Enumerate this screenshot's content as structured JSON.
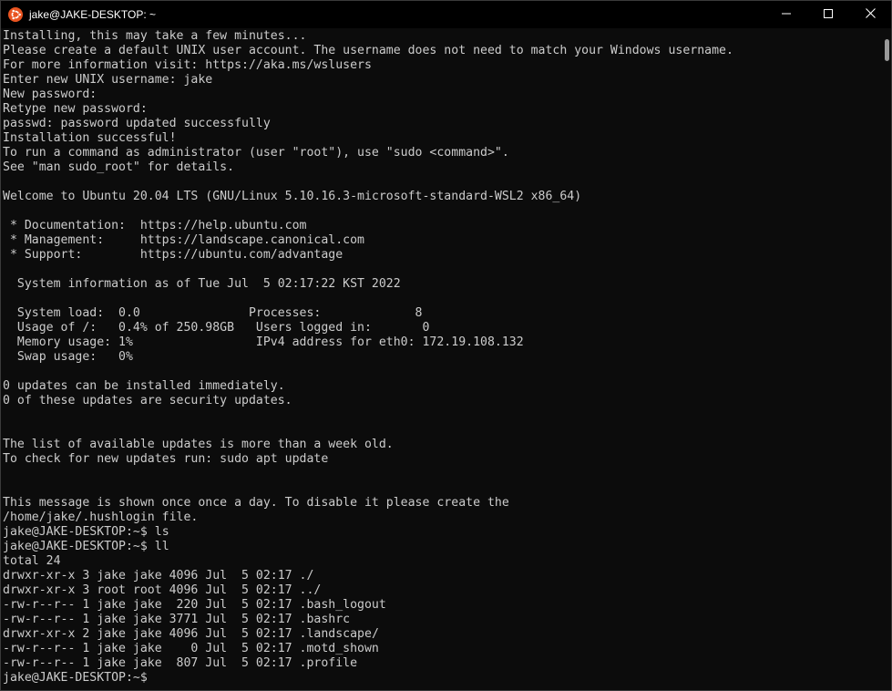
{
  "window": {
    "title": "jake@JAKE-DESKTOP: ~",
    "app_icon": "ubuntu-icon",
    "controls": [
      "minimize-icon",
      "maximize-icon",
      "close-icon"
    ]
  },
  "colors": {
    "background": "#0c0c0c",
    "text": "#cccccc",
    "prompt_green": "#13a10e",
    "directory_blue": "#3b78ff",
    "ubuntu_orange": "#e95420"
  },
  "terminal": {
    "lines": [
      [
        {
          "t": "Installing, this may take a few minutes..."
        }
      ],
      [
        {
          "t": "Please create a default UNIX user account. The username does not need to match your Windows username."
        }
      ],
      [
        {
          "t": "For more information visit: https://aka.ms/wslusers"
        }
      ],
      [
        {
          "t": "Enter new UNIX username: jake"
        }
      ],
      [
        {
          "t": "New password:"
        }
      ],
      [
        {
          "t": "Retype new password:"
        }
      ],
      [
        {
          "t": "passwd: password updated successfully"
        }
      ],
      [
        {
          "t": "Installation successful!"
        }
      ],
      [
        {
          "t": "To run a command as administrator (user \"root\"), use \"sudo <command>\"."
        }
      ],
      [
        {
          "t": "See \"man sudo_root\" for details."
        }
      ],
      [
        {
          "t": ""
        }
      ],
      [
        {
          "t": "Welcome to Ubuntu 20.04 LTS (GNU/Linux 5.10.16.3-microsoft-standard-WSL2 x86_64)"
        }
      ],
      [
        {
          "t": ""
        }
      ],
      [
        {
          "t": " * Documentation:  https://help.ubuntu.com"
        }
      ],
      [
        {
          "t": " * Management:     https://landscape.canonical.com"
        }
      ],
      [
        {
          "t": " * Support:        https://ubuntu.com/advantage"
        }
      ],
      [
        {
          "t": ""
        }
      ],
      [
        {
          "t": "  System information as of Tue Jul  5 02:17:22 KST 2022"
        }
      ],
      [
        {
          "t": ""
        }
      ],
      [
        {
          "t": "  System load:  0.0               Processes:             8"
        }
      ],
      [
        {
          "t": "  Usage of /:   0.4% of 250.98GB   Users logged in:       0"
        }
      ],
      [
        {
          "t": "  Memory usage: 1%                 IPv4 address for eth0: 172.19.108.132"
        }
      ],
      [
        {
          "t": "  Swap usage:   0%"
        }
      ],
      [
        {
          "t": ""
        }
      ],
      [
        {
          "t": "0 updates can be installed immediately."
        }
      ],
      [
        {
          "t": "0 of these updates are security updates."
        }
      ],
      [
        {
          "t": ""
        }
      ],
      [
        {
          "t": ""
        }
      ],
      [
        {
          "t": "The list of available updates is more than a week old."
        }
      ],
      [
        {
          "t": "To check for new updates run: sudo apt update"
        }
      ],
      [
        {
          "t": ""
        }
      ],
      [
        {
          "t": ""
        }
      ],
      [
        {
          "t": "This message is shown once once a day. To disable it please create the"
        }
      ],
      [
        {
          "t": "/home/jake/.hushlogin file."
        }
      ],
      [
        {
          "t": "jake@JAKE-DESKTOP:",
          "c": "green"
        },
        {
          "t": "~"
        },
        {
          "t": "$ ls"
        }
      ],
      [
        {
          "t": "jake@JAKE-DESKTOP:",
          "c": "green"
        },
        {
          "t": "~"
        },
        {
          "t": "$ ll"
        }
      ],
      [
        {
          "t": "total 24"
        }
      ],
      [
        {
          "t": "drwxr-xr-x 3 jake jake 4096 Jul  5 02:17 "
        },
        {
          "t": "./",
          "c": "blue"
        }
      ],
      [
        {
          "t": "drwxr-xr-x 3 root root 4096 Jul  5 02:17 "
        },
        {
          "t": "../",
          "c": "blue"
        }
      ],
      [
        {
          "t": "-rw-r--r-- 1 jake jake  220 Jul  5 02:17 .bash_logout"
        }
      ],
      [
        {
          "t": "-rw-r--r-- 1 jake jake 3771 Jul  5 02:17 .bashrc"
        }
      ],
      [
        {
          "t": "drwxr-xr-x 2 jake jake 4096 Jul  5 02:17 "
        },
        {
          "t": ".landscape",
          "c": "blue"
        },
        {
          "t": "/"
        }
      ],
      [
        {
          "t": "-rw-r--r-- 1 jake jake    0 Jul  5 02:17 .motd_shown"
        }
      ],
      [
        {
          "t": "-rw-r--r-- 1 jake jake  807 Jul  5 02:17 .profile"
        }
      ],
      [
        {
          "t": "jake@JAKE-DESKTOP:",
          "c": "green"
        },
        {
          "t": "~"
        },
        {
          "t": "$ "
        }
      ]
    ]
  }
}
